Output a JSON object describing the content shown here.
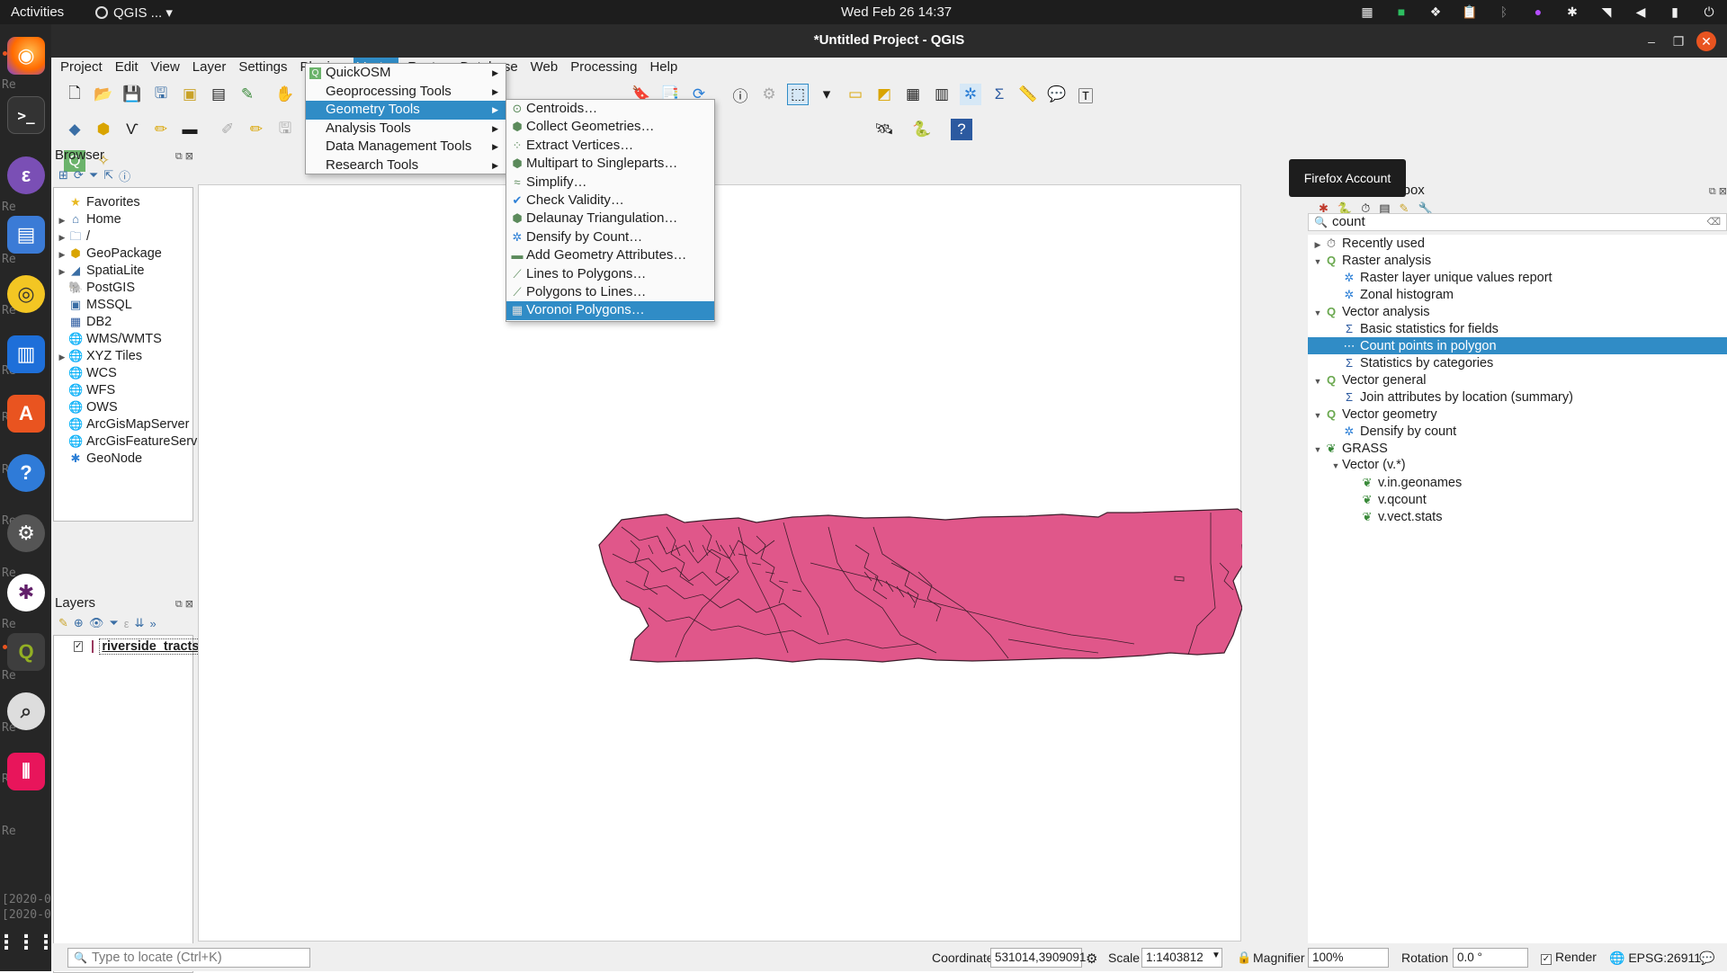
{
  "topbar": {
    "activities": "Activities",
    "app_name": "QGIS ...",
    "clock": "Wed Feb 26  14:37",
    "tray_icons": [
      "grid-icon",
      "evernote-icon",
      "dropbox-icon",
      "clipboard-icon",
      "bluetooth-icon",
      "firefox-profile-icon",
      "slack-tray-icon",
      "wifi-icon",
      "volume-icon",
      "battery-icon",
      "power-icon"
    ]
  },
  "dock": {
    "apps": [
      "firefox",
      "terminal",
      "emacs",
      "files",
      "rhythmbox",
      "writer",
      "software",
      "help",
      "settings",
      "slack",
      "qgis",
      "search",
      "other"
    ],
    "bg_lines": [
      "Re",
      "Re",
      "Re",
      "Re",
      "Re",
      "Re",
      "Re",
      "Re",
      "Re",
      "Re",
      "Re",
      "Re",
      "Re",
      "Re"
    ],
    "bg_log": [
      "[2020-0",
      "[2020-0"
    ]
  },
  "window": {
    "title": "*Untitled Project - QGIS"
  },
  "menubar": [
    {
      "label": "Project"
    },
    {
      "label": "Edit"
    },
    {
      "label": "View"
    },
    {
      "label": "Layer"
    },
    {
      "label": "Settings"
    },
    {
      "label": "Plugins"
    },
    {
      "label": "Vector"
    },
    {
      "label": "Raster"
    },
    {
      "label": "Database"
    },
    {
      "label": "Web"
    },
    {
      "label": "Processing"
    },
    {
      "label": "Help"
    }
  ],
  "vector_menu": [
    {
      "label": "QuickOSM",
      "icon": "quickosm-icon"
    },
    {
      "label": "Geoprocessing Tools"
    },
    {
      "label": "Geometry Tools"
    },
    {
      "label": "Analysis Tools"
    },
    {
      "label": "Data Management Tools"
    },
    {
      "label": "Research Tools"
    }
  ],
  "geometry_menu": [
    {
      "label": "Centroids…",
      "icon": "centroids-icon"
    },
    {
      "label": "Collect Geometries…",
      "icon": "collect-icon"
    },
    {
      "label": "Extract Vertices…",
      "icon": "vertices-icon"
    },
    {
      "label": "Multipart to Singleparts…",
      "icon": "multipart-icon"
    },
    {
      "label": "Simplify…",
      "icon": "simplify-icon"
    },
    {
      "label": "Check Validity…",
      "icon": "check-icon"
    },
    {
      "label": "Delaunay Triangulation…",
      "icon": "delaunay-icon"
    },
    {
      "label": "Densify by Count…",
      "icon": "densify-icon"
    },
    {
      "label": "Add Geometry Attributes…",
      "icon": "attributes-icon"
    },
    {
      "label": "Lines to Polygons…",
      "icon": "lines-polygons-icon"
    },
    {
      "label": "Polygons to Lines…",
      "icon": "polygons-lines-icon"
    },
    {
      "label": "Voronoi Polygons…",
      "icon": "voronoi-icon"
    }
  ],
  "browser": {
    "title": "Browser",
    "items": [
      {
        "label": "Favorites",
        "icon": "star-icon",
        "arrow": ""
      },
      {
        "label": "Home",
        "icon": "home-icon",
        "arrow": "▶"
      },
      {
        "label": "/",
        "icon": "folder-icon",
        "arrow": "▶"
      },
      {
        "label": "GeoPackage",
        "icon": "geopackage-icon",
        "arrow": "▶"
      },
      {
        "label": "SpatiaLite",
        "icon": "spatialite-icon",
        "arrow": "▶"
      },
      {
        "label": "PostGIS",
        "icon": "postgis-icon",
        "arrow": ""
      },
      {
        "label": "MSSQL",
        "icon": "mssql-icon",
        "arrow": ""
      },
      {
        "label": "DB2",
        "icon": "db2-icon",
        "arrow": ""
      },
      {
        "label": "WMS/WMTS",
        "icon": "wms-icon",
        "arrow": ""
      },
      {
        "label": "XYZ Tiles",
        "icon": "xyz-icon",
        "arrow": "▶"
      },
      {
        "label": "WCS",
        "icon": "wcs-icon",
        "arrow": ""
      },
      {
        "label": "WFS",
        "icon": "wfs-icon",
        "arrow": ""
      },
      {
        "label": "OWS",
        "icon": "ows-icon",
        "arrow": ""
      },
      {
        "label": "ArcGisMapServer",
        "icon": "arcgis-icon",
        "arrow": ""
      },
      {
        "label": "ArcGisFeatureServer",
        "icon": "arcgis-icon",
        "arrow": ""
      },
      {
        "label": "GeoNode",
        "icon": "geonode-icon",
        "arrow": ""
      }
    ]
  },
  "layers": {
    "title": "Layers",
    "items": [
      {
        "label": "riverside_tracts",
        "checked": "✓",
        "color": "#e0578a"
      }
    ]
  },
  "toolbox": {
    "title": "Processing Toolbox",
    "search_value": "count",
    "rows": [
      {
        "label": "Recently used",
        "level": 0,
        "arrow": "▶",
        "icon": "clock-icon"
      },
      {
        "label": "Raster analysis",
        "level": 0,
        "arrow": "▼",
        "icon": "qgis-icon"
      },
      {
        "label": "Raster layer unique values report",
        "level": 1,
        "arrow": "",
        "icon": "gear-icon"
      },
      {
        "label": "Zonal histogram",
        "level": 1,
        "arrow": "",
        "icon": "gear-icon"
      },
      {
        "label": "Vector analysis",
        "level": 0,
        "arrow": "▼",
        "icon": "qgis-icon"
      },
      {
        "label": "Basic statistics for fields",
        "level": 1,
        "arrow": "",
        "icon": "sigma-icon"
      },
      {
        "label": "Count points in polygon",
        "level": 1,
        "arrow": "",
        "icon": "count-icon",
        "selected": true
      },
      {
        "label": "Statistics by categories",
        "level": 1,
        "arrow": "",
        "icon": "sigma-icon"
      },
      {
        "label": "Vector general",
        "level": 0,
        "arrow": "▼",
        "icon": "qgis-icon"
      },
      {
        "label": "Join attributes by location (summary)",
        "level": 1,
        "arrow": "",
        "icon": "sigma-icon"
      },
      {
        "label": "Vector geometry",
        "level": 0,
        "arrow": "▼",
        "icon": "qgis-icon"
      },
      {
        "label": "Densify by count",
        "level": 1,
        "arrow": "",
        "icon": "gear-icon"
      },
      {
        "label": "GRASS",
        "level": 0,
        "arrow": "▼",
        "icon": "grass-icon"
      },
      {
        "label": "Vector (v.*)",
        "level": 1,
        "arrow": "▼",
        "icon": ""
      },
      {
        "label": "v.in.geonames",
        "level": 2,
        "arrow": "",
        "icon": "grass-icon"
      },
      {
        "label": "v.qcount",
        "level": 2,
        "arrow": "",
        "icon": "grass-icon"
      },
      {
        "label": "v.vect.stats",
        "level": 2,
        "arrow": "",
        "icon": "grass-icon"
      }
    ]
  },
  "tooltip": "Firefox Account",
  "statusbar": {
    "locate_placeholder": "Type to locate (Ctrl+K)",
    "coordinate_label": "Coordinate",
    "coordinate_value": "531014,3909091",
    "scale_label": "Scale",
    "scale_value": "1:1403812",
    "magnifier_label": "Magnifier",
    "magnifier_value": "100%",
    "rotation_label": "Rotation",
    "rotation_value": "0.0 °",
    "render_label": "Render",
    "render_checked": "✓",
    "crs": "EPSG:26911"
  },
  "colors": {
    "accent": "#308cc6",
    "layer_fill": "#e0578a",
    "ubuntu_orange": "#e95420"
  }
}
